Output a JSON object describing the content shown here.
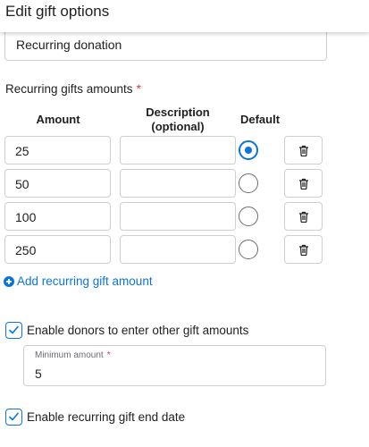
{
  "header": {
    "title": "Edit gift options"
  },
  "name_field": {
    "value": "Recurring donation"
  },
  "amounts_section": {
    "label": "Recurring gifts amounts",
    "required_marker": "*",
    "columns": {
      "amount": "Amount",
      "description": "Description (optional)",
      "default": "Default"
    },
    "rows": [
      {
        "amount": "25",
        "description": "",
        "is_default": true
      },
      {
        "amount": "50",
        "description": "",
        "is_default": false
      },
      {
        "amount": "100",
        "description": "",
        "is_default": false
      },
      {
        "amount": "250",
        "description": "",
        "is_default": false
      }
    ],
    "add_label": "Add recurring gift amount"
  },
  "other_amounts": {
    "label": "Enable donors to enter other gift amounts",
    "checked": true,
    "minimum": {
      "label": "Minimum amount",
      "required_marker": "*",
      "value": "5"
    }
  },
  "end_date": {
    "label": "Enable recurring gift end date",
    "checked": true
  },
  "colors": {
    "accent": "#0974de",
    "required": "#d93a3f",
    "border": "#cdcfd2"
  },
  "icons": {
    "delete": "trash-icon",
    "add": "plus-circle-icon",
    "check": "checkmark-icon"
  }
}
